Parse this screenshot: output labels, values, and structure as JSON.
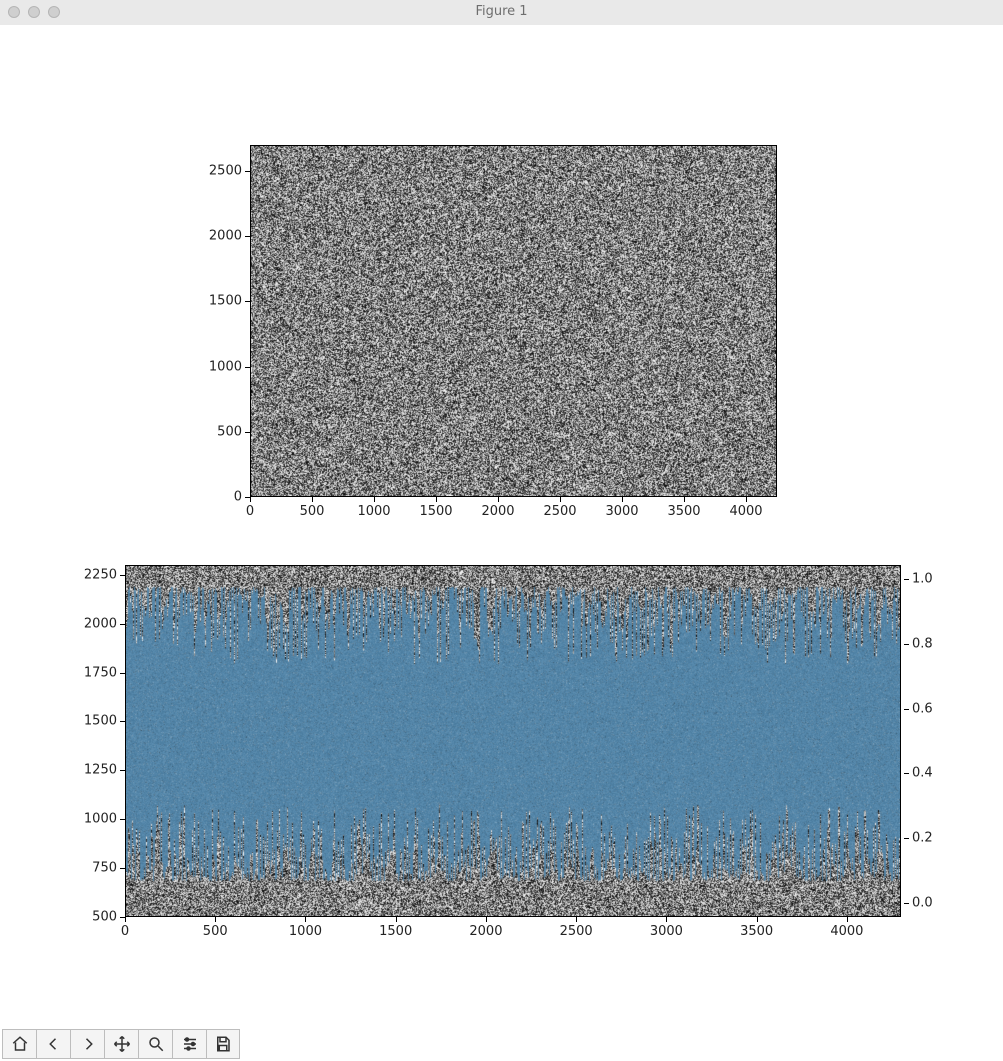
{
  "window": {
    "title": "Figure 1"
  },
  "toolbar": {
    "items": [
      {
        "name": "home-button",
        "tip": "Home"
      },
      {
        "name": "back-button",
        "tip": "Back"
      },
      {
        "name": "forward-button",
        "tip": "Forward"
      },
      {
        "name": "pan-button",
        "tip": "Pan"
      },
      {
        "name": "zoom-button",
        "tip": "Zoom"
      },
      {
        "name": "configure-button",
        "tip": "Configure subplots"
      },
      {
        "name": "save-button",
        "tip": "Save"
      }
    ]
  },
  "chart_data": [
    {
      "type": "heatmap",
      "title": "",
      "xlabel": "",
      "ylabel": "",
      "xlim": [
        0,
        4250
      ],
      "ylim": [
        0,
        2700
      ],
      "xticks": [
        0,
        500,
        1000,
        1500,
        2000,
        2500,
        3000,
        3500,
        4000
      ],
      "yticks": [
        0,
        500,
        1000,
        1500,
        2000,
        2500
      ],
      "description": "dense random grayscale noise image, uniform over entire axes",
      "cmap": "gray",
      "value_range": [
        0,
        1
      ]
    },
    {
      "type": "heatmap",
      "title": "",
      "xlabel": "",
      "ylabel": "",
      "xlim": [
        0,
        4300
      ],
      "ylim": [
        500,
        2300
      ],
      "xticks": [
        0,
        500,
        1000,
        1500,
        2000,
        2500,
        3000,
        3500,
        4000
      ],
      "yticks": [
        500,
        750,
        1000,
        1250,
        1500,
        1750,
        2000,
        2250
      ],
      "colorbar_ticks": [
        0.0,
        0.2,
        0.4,
        0.6,
        0.8,
        1.0
      ],
      "description": "grayscale noise background with a dominant steel-blue overlay band spanning roughly y≈750 to y≈2200; top noise edge and bottom noise edge are ragged/spiky; right-side colorbar 0.0–1.0",
      "overlay_color": "#4f86ab",
      "cmap": "gray",
      "value_range": [
        0,
        1
      ]
    }
  ]
}
